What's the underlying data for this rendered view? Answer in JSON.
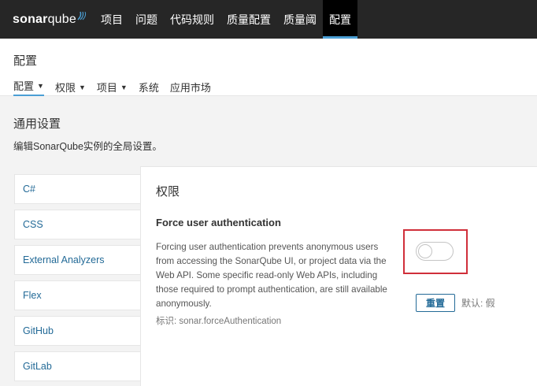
{
  "topnav": {
    "logo_sonar": "sonar",
    "logo_qube": "qube",
    "items": [
      {
        "label": "项目"
      },
      {
        "label": "问题"
      },
      {
        "label": "代码规则"
      },
      {
        "label": "质量配置"
      },
      {
        "label": "质量阈"
      },
      {
        "label": "配置",
        "active": true
      }
    ]
  },
  "page": {
    "title": "配置",
    "subnav": [
      {
        "label": "配置",
        "dropdown": true,
        "active": true
      },
      {
        "label": "权限",
        "dropdown": true
      },
      {
        "label": "项目",
        "dropdown": true
      },
      {
        "label": "系统",
        "dropdown": false
      },
      {
        "label": "应用市场",
        "dropdown": false
      }
    ]
  },
  "general": {
    "title": "通用设置",
    "description": "编辑SonarQube实例的全局设置。"
  },
  "categories": [
    {
      "label": "C#"
    },
    {
      "label": "CSS"
    },
    {
      "label": "External Analyzers"
    },
    {
      "label": "Flex"
    },
    {
      "label": "GitHub"
    },
    {
      "label": "GitLab"
    }
  ],
  "panel": {
    "title": "权限",
    "setting_name": "Force user authentication",
    "setting_description": "Forcing user authentication prevents anonymous users from accessing the SonarQube UI, or project data via the Web API. Some specific read-only Web APIs, including those required to prompt authentication, are still available anonymously.",
    "setting_key": "标识: sonar.forceAuthentication",
    "toggle_on": false,
    "reset_label": "重置",
    "default_label": "默认: 假"
  },
  "colors": {
    "topbar": "#262626",
    "link": "#236a97",
    "highlight": "#d02f3a",
    "accent": "#4b9fd5"
  }
}
